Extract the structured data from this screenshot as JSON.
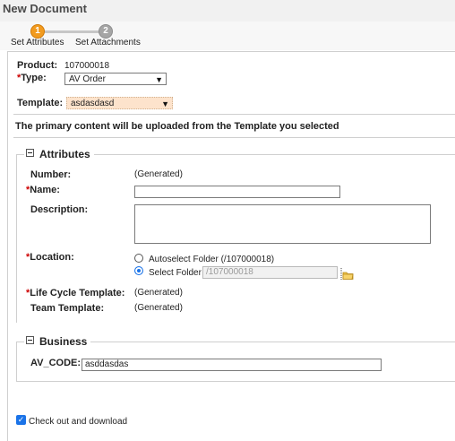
{
  "window": {
    "title": "New Document"
  },
  "wizard": {
    "steps": [
      {
        "number": "1",
        "label": "Set Attributes",
        "active": true
      },
      {
        "number": "2",
        "label": "Set Attachments",
        "active": false
      }
    ]
  },
  "form": {
    "product": {
      "label": "Product:",
      "value": "107000018"
    },
    "type": {
      "required_mark": "*",
      "label": "Type:",
      "value": "AV Order"
    },
    "template": {
      "label": "Template:",
      "value": "asdasdasd"
    },
    "notice": "The primary content will be uploaded from the Template you selected"
  },
  "attributes": {
    "legend": "Attributes",
    "number": {
      "label": "Number:",
      "value": "(Generated)"
    },
    "name": {
      "required_mark": "*",
      "label": "Name:",
      "value": ""
    },
    "description": {
      "label": "Description:",
      "value": ""
    },
    "location": {
      "required_mark": "*",
      "label": "Location:",
      "options": [
        {
          "label": "Autoselect Folder (/107000018)",
          "selected": false
        },
        {
          "label": "Select Folder",
          "selected": true,
          "value": "/107000018"
        }
      ]
    },
    "life_cycle": {
      "required_mark": "*",
      "label": "Life Cycle Template:",
      "value": "(Generated)"
    },
    "team_template": {
      "label": "Team Template:",
      "value": "(Generated)"
    }
  },
  "business": {
    "legend": "Business",
    "av_code": {
      "label": "AV_CODE:",
      "value": "asddasdas"
    }
  },
  "checkout": {
    "label": "Check out and download",
    "checked": true
  },
  "colors": {
    "active_step": "#f29b1f",
    "inactive_step": "#a5a5a5",
    "required": "#cc0000",
    "checkbox": "#1a73e8",
    "template_highlight": "#fde3cc"
  }
}
